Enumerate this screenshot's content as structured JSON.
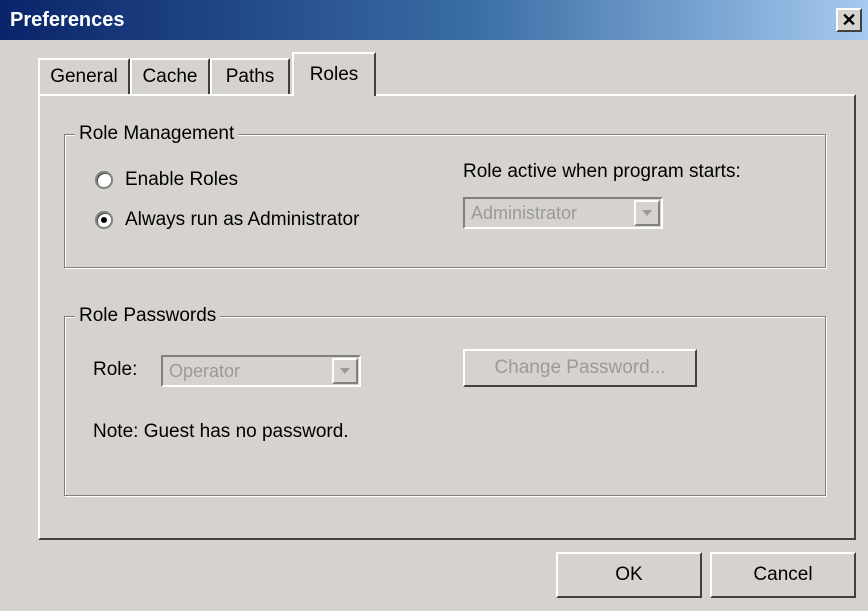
{
  "window": {
    "title": "Preferences",
    "close_glyph": "✕"
  },
  "tabs": [
    {
      "label": "General"
    },
    {
      "label": "Cache"
    },
    {
      "label": "Paths"
    },
    {
      "label": "Roles"
    }
  ],
  "active_tab": "Roles",
  "role_management": {
    "legend": "Role Management",
    "enable_roles_label": "Enable Roles",
    "enable_roles_selected": false,
    "always_admin_label": "Always run as Administrator",
    "always_admin_selected": true,
    "startup_role_label": "Role active when program starts:",
    "startup_role_value": "Administrator",
    "startup_role_enabled": false
  },
  "role_passwords": {
    "legend": "Role Passwords",
    "role_label": "Role:",
    "role_value": "Operator",
    "role_enabled": false,
    "change_password_label": "Change Password...",
    "change_password_enabled": false,
    "note": "Note:  Guest has no password."
  },
  "buttons": {
    "ok_label": "OK",
    "cancel_label": "Cancel"
  },
  "icons": {
    "close": "close-icon",
    "dropdown": "chevron-down-icon",
    "radio": "radio-dot-icon"
  },
  "colors": {
    "face": "#d6d3ce",
    "title_start": "#0a246a",
    "title_end": "#a6caf0",
    "disabled_text": "#9a9a9a"
  }
}
